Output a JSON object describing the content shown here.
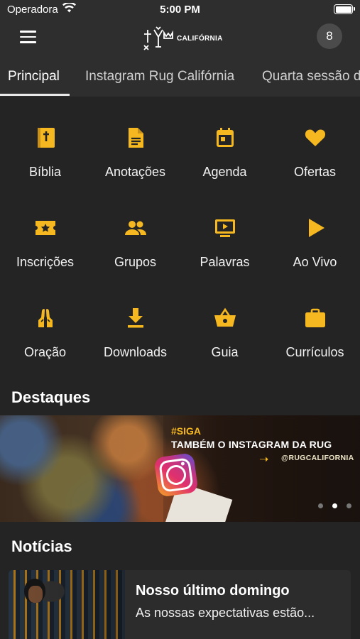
{
  "status_bar": {
    "carrier": "Operadora",
    "time": "5:00 PM"
  },
  "header": {
    "logo_text": "CALIFÓRNIA",
    "notification_count": "8"
  },
  "tabs": [
    {
      "label": "Principal",
      "active": true
    },
    {
      "label": "Instagram Rug Califórnia",
      "active": false
    },
    {
      "label": "Quarta sessão de",
      "active": false
    }
  ],
  "grid": [
    {
      "label": "Bíblia",
      "icon": "bible-icon"
    },
    {
      "label": "Anotações",
      "icon": "document-icon"
    },
    {
      "label": "Agenda",
      "icon": "calendar-icon"
    },
    {
      "label": "Ofertas",
      "icon": "heart-icon"
    },
    {
      "label": "Inscrições",
      "icon": "ticket-star-icon"
    },
    {
      "label": "Grupos",
      "icon": "people-icon"
    },
    {
      "label": "Palavras",
      "icon": "tv-play-icon"
    },
    {
      "label": "Ao Vivo",
      "icon": "play-icon"
    },
    {
      "label": "Oração",
      "icon": "praying-hands-icon"
    },
    {
      "label": "Downloads",
      "icon": "download-icon"
    },
    {
      "label": "Guia",
      "icon": "basket-icon"
    },
    {
      "label": "Currículos",
      "icon": "briefcase-icon"
    }
  ],
  "highlights": {
    "title": "Destaques",
    "banner": {
      "hashtag": "#SIGA",
      "headline": "TAMBÉM O INSTAGRAM DA RUG",
      "handle": "@RUGCALIFORNIA"
    },
    "pager": {
      "count": 3,
      "active_index": 1
    }
  },
  "news": {
    "title": "Notícias",
    "items": [
      {
        "title": "Nosso último domingo",
        "excerpt": "As nossas expectativas estão..."
      }
    ]
  },
  "colors": {
    "accent": "#F5B820",
    "background": "#242424",
    "bar": "#2E2E2E"
  }
}
